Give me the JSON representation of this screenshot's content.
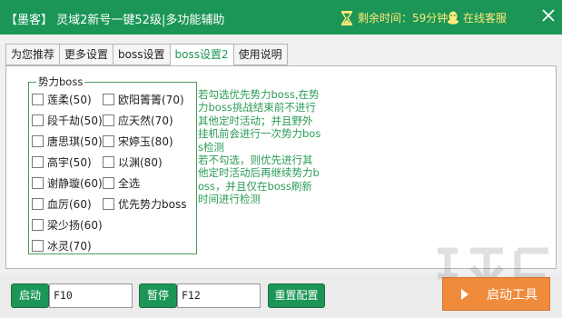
{
  "window": {
    "title": "【墨客】 灵域2新号一键52级|多功能辅助",
    "remaining_time": "剩余时间：59分钟",
    "online_service": "在线客服",
    "accent_color": "#1b9656",
    "icons": {
      "timer": "hourglass-icon",
      "service": "qq-penguin-icon",
      "close": "close-icon"
    }
  },
  "tabs": [
    {
      "label": "为您推荐",
      "active": false
    },
    {
      "label": "更多设置",
      "active": false
    },
    {
      "label": "boss设置",
      "active": false
    },
    {
      "label": "boss设置2",
      "active": true
    },
    {
      "label": "使用说明",
      "active": false
    }
  ],
  "boss_group": {
    "legend": "势力boss",
    "col1": [
      {
        "label": "莲柔(50)",
        "checked": false
      },
      {
        "label": "段千劫(50)",
        "checked": false
      },
      {
        "label": "唐思琪(50)",
        "checked": false
      },
      {
        "label": "高宇(50)",
        "checked": false
      },
      {
        "label": "谢静璇(60)",
        "checked": false
      },
      {
        "label": "血厉(60)",
        "checked": false
      },
      {
        "label": "梁少扬(60)",
        "checked": false
      },
      {
        "label": "冰灵(70)",
        "checked": false
      }
    ],
    "col2": [
      {
        "label": "欧阳箐箐(70)",
        "checked": false
      },
      {
        "label": "应天然(70)",
        "checked": false
      },
      {
        "label": "宋婷玉(80)",
        "checked": false
      },
      {
        "label": "以渊(80)",
        "checked": false
      },
      {
        "label": "全选",
        "checked": false
      },
      {
        "label": "优先势力boss",
        "checked": false
      }
    ]
  },
  "description": "若勾选优先势力boss,在势力boss挑战结束前不进行其他定时活动；并且野外挂机前会进行一次势力boss检测\n若不勾选，则优先进行其他定时活动后再继续势力boss，并且仅在boss刷新时间进行检测",
  "description_color": "#2b9c56",
  "bottom": {
    "start_label": "启动",
    "start_key": "F10",
    "pause_label": "暂停",
    "pause_key": "F12",
    "reset_label": "重置配置",
    "launch_label": "启动工具",
    "launch_color": "#f08b3c"
  }
}
